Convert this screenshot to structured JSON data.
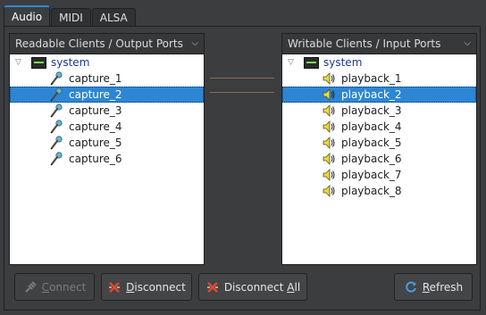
{
  "tabs": [
    {
      "label": "Audio",
      "active": true
    },
    {
      "label": "MIDI",
      "active": false
    },
    {
      "label": "ALSA",
      "active": false
    }
  ],
  "left_panel": {
    "header": "Readable Clients / Output Ports",
    "client": "system",
    "ports": [
      "capture_1",
      "capture_2",
      "capture_3",
      "capture_4",
      "capture_5",
      "capture_6"
    ],
    "selected_index": 1
  },
  "right_panel": {
    "header": "Writable Clients / Input Ports",
    "client": "system",
    "ports": [
      "playback_1",
      "playback_2",
      "playback_3",
      "playback_4",
      "playback_5",
      "playback_6",
      "playback_7",
      "playback_8"
    ],
    "selected_index": 1
  },
  "buttons": {
    "connect": {
      "pre": "",
      "ul": "C",
      "post": "onnect",
      "enabled": false
    },
    "disconnect": {
      "pre": "",
      "ul": "D",
      "post": "isconnect",
      "enabled": true
    },
    "disconnect_all": {
      "pre": "Disconnect ",
      "ul": "A",
      "post": "ll",
      "enabled": true
    },
    "refresh": {
      "pre": "",
      "ul": "R",
      "post": "efresh",
      "enabled": true
    }
  },
  "colors": {
    "accent": "#2d86d4",
    "background": "#3b3d3f",
    "connection_line": "#8a6c5a"
  }
}
